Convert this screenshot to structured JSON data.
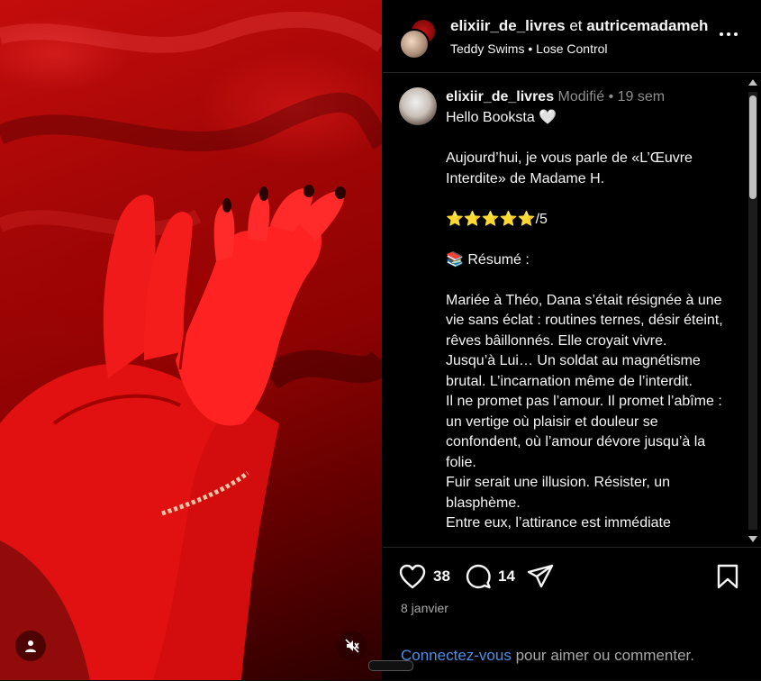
{
  "header": {
    "user1": "elixiir_de_livres",
    "conjunction": "et",
    "user2": "autricemadameh",
    "music_artist": "Teddy Swims",
    "music_separator": "•",
    "music_track": "Lose Control",
    "more_icon": "more-horizontal-icon"
  },
  "caption": {
    "username": "elixiir_de_livres",
    "edited": "Modifié",
    "dot": "•",
    "age": "19 sem",
    "lines": [
      "Hello Booksta 🤍",
      "",
      "Aujourd’hui, je vous parle de «L’Œuvre Interdite» de Madame H.",
      "",
      "⭐⭐⭐⭐⭐/5",
      "",
      "📚 Résumé :",
      "",
      "Mariée à Théo, Dana s’était résignée à une vie sans éclat : routines ternes, désir éteint, rêves bâillonnés. Elle croyait vivre.",
      "Jusqu’à Lui… Un soldat au magnétisme brutal. L’incarnation même de l’interdit.",
      "Il ne promet pas l’amour. Il promet l’abîme : un vertige où plaisir et douleur se confondent, où l’amour dévore jusqu’à la folie.",
      "Fuir serait une illusion. Résister, un blasphème.",
      "Entre eux, l’attirance est immédiate"
    ]
  },
  "actions": {
    "likes": "38",
    "comments": "14",
    "like_icon": "heart-icon",
    "comment_icon": "comment-icon",
    "share_icon": "send-icon",
    "save_icon": "bookmark-icon"
  },
  "date": "8 janvier",
  "login_prompt": {
    "link": "Connectez-vous",
    "rest": " pour aimer ou commenter."
  },
  "media": {
    "tag_icon": "user-tag-icon",
    "mute_icon": "muted-speaker-icon"
  },
  "colors": {
    "accent_link": "#4a8fe6",
    "muted_text": "#8e8e8e",
    "media_red": "#c40c0c"
  }
}
